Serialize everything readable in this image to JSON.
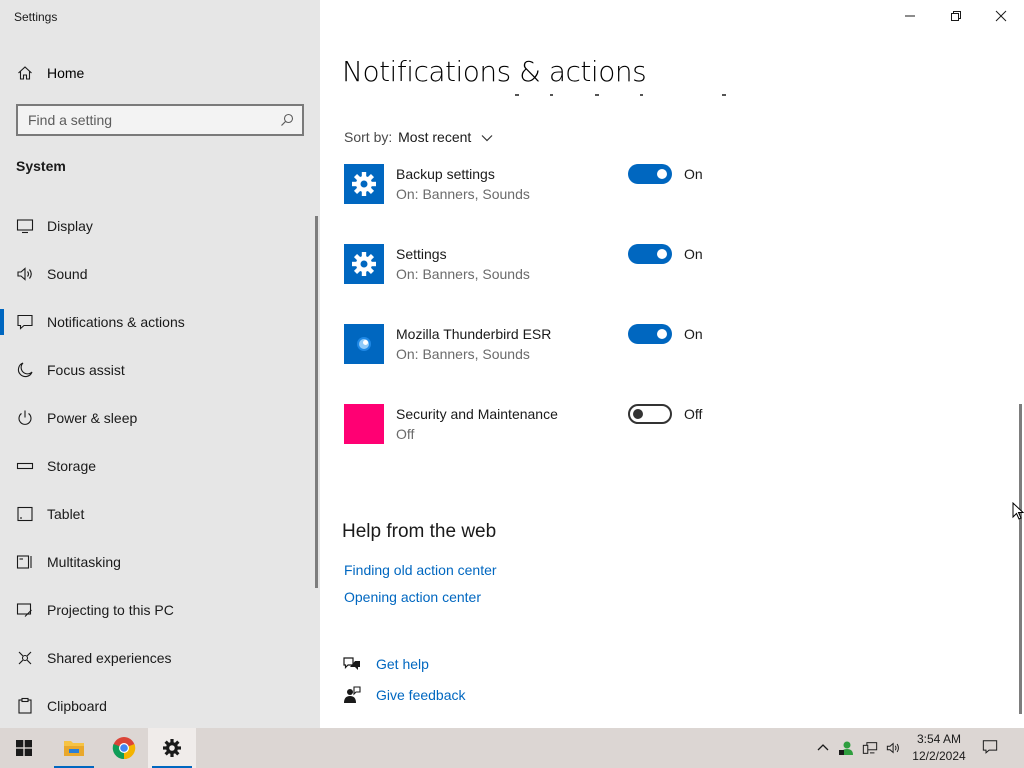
{
  "app_title": "Settings",
  "sidebar": {
    "home_label": "Home",
    "search_placeholder": "Find a setting",
    "section_title": "System",
    "items": [
      {
        "label": "Display",
        "icon": "monitor-icon"
      },
      {
        "label": "Sound",
        "icon": "speaker-icon"
      },
      {
        "label": "Notifications & actions",
        "icon": "notification-icon",
        "active": true
      },
      {
        "label": "Focus assist",
        "icon": "moon-icon"
      },
      {
        "label": "Power & sleep",
        "icon": "power-icon"
      },
      {
        "label": "Storage",
        "icon": "storage-icon"
      },
      {
        "label": "Tablet",
        "icon": "tablet-icon"
      },
      {
        "label": "Multitasking",
        "icon": "multitasking-icon"
      },
      {
        "label": "Projecting to this PC",
        "icon": "projecting-icon"
      },
      {
        "label": "Shared experiences",
        "icon": "shared-experiences-icon"
      },
      {
        "label": "Clipboard",
        "icon": "clipboard-icon"
      }
    ]
  },
  "main": {
    "title": "Notifications & actions",
    "sort_label": "Sort by:",
    "sort_value": "Most recent",
    "apps": [
      {
        "name": "Backup settings",
        "sub": "On: Banners, Sounds",
        "state": "On",
        "tile_color": "#0067c0",
        "icon": "gear-icon"
      },
      {
        "name": "Settings",
        "sub": "On: Banners, Sounds",
        "state": "On",
        "tile_color": "#0067c0",
        "icon": "gear-icon"
      },
      {
        "name": "Mozilla Thunderbird ESR",
        "sub": "On: Banners, Sounds",
        "state": "On",
        "tile_color": "#0067c0",
        "icon": "thunderbird-icon"
      },
      {
        "name": "Security and Maintenance",
        "sub": "Off",
        "state": "Off",
        "tile_color": "#ff0073",
        "icon": "security-maintenance-icon"
      }
    ],
    "help_title": "Help from the web",
    "help_links": [
      "Finding old action center",
      "Opening action center"
    ],
    "get_help": "Get help",
    "give_feedback": "Give feedback"
  },
  "taskbar": {
    "time": "3:54 AM",
    "date": "12/2/2024"
  },
  "colors": {
    "accent": "#0067c0",
    "sidebar_bg": "#e6e6e6"
  }
}
